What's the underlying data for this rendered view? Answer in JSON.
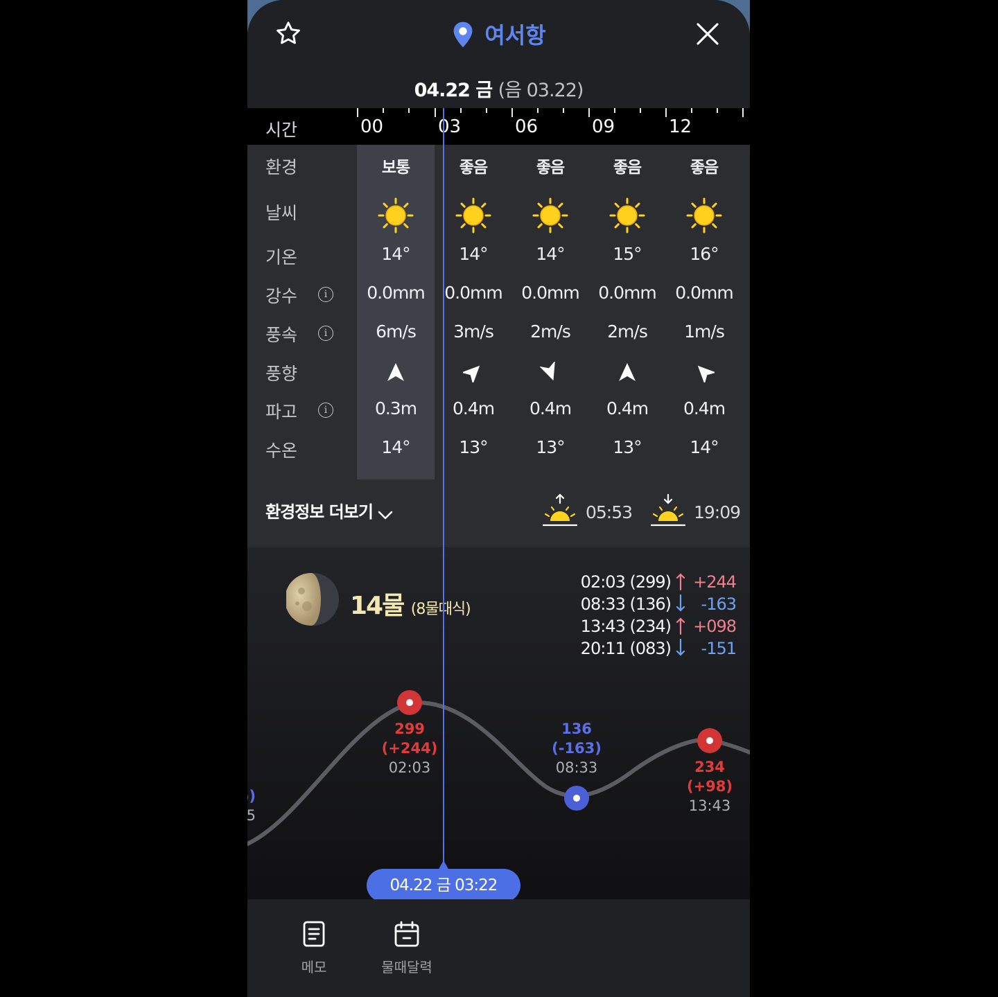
{
  "header": {
    "location": "여서항",
    "date_main": "04.22 금",
    "date_lunar": "(음 03.22)"
  },
  "time_row": {
    "label": "시간",
    "hours": [
      "00",
      "03",
      "06",
      "09",
      "12"
    ]
  },
  "row_labels": [
    "환경",
    "날씨",
    "기온",
    "강수",
    "풍속",
    "풍향",
    "파고",
    "수온"
  ],
  "columns": [
    {
      "env": "보통",
      "weather": "sun-icon",
      "temp": "14°",
      "rain": "0.0mm",
      "wind": "6m/s",
      "dir_deg": 0,
      "wave": "0.3m",
      "water": "14°"
    },
    {
      "env": "좋음",
      "weather": "sun-icon",
      "temp": "14°",
      "rain": "0.0mm",
      "wind": "3m/s",
      "dir_deg": 45,
      "wave": "0.4m",
      "water": "13°"
    },
    {
      "env": "좋음",
      "weather": "sun-icon",
      "temp": "14°",
      "rain": "0.0mm",
      "wind": "2m/s",
      "dir_deg": 160,
      "wave": "0.4m",
      "water": "13°"
    },
    {
      "env": "좋음",
      "weather": "sun-icon",
      "temp": "15°",
      "rain": "0.0mm",
      "wind": "2m/s",
      "dir_deg": 0,
      "wave": "0.4m",
      "water": "13°"
    },
    {
      "env": "좋음",
      "weather": "sun-icon",
      "temp": "16°",
      "rain": "0.0mm",
      "wind": "1m/s",
      "dir_deg": 315,
      "wave": "0.4m",
      "water": "14°"
    }
  ],
  "env_more": {
    "label": "환경정보 더보기",
    "sunrise": "05:53",
    "sunset": "19:09"
  },
  "tide": {
    "moon_label": "14물",
    "moon_sub": "(8물때식)",
    "entries": [
      {
        "time": "02:03 (299)",
        "dir": "up",
        "delta": "+244"
      },
      {
        "time": "08:33 (136)",
        "dir": "down",
        "delta": "-163"
      },
      {
        "time": "13:43 (234)",
        "dir": "up",
        "delta": "+098"
      },
      {
        "time": "20:11 (083)",
        "dir": "down",
        "delta": "-151"
      }
    ],
    "chart_points": [
      {
        "level": "299",
        "change": "(+244)",
        "time": "02:03",
        "kind": "high"
      },
      {
        "level": "136",
        "change": "(-163)",
        "time": "08:33",
        "kind": "low"
      },
      {
        "level": "234",
        "change": "(+98)",
        "time": "13:43",
        "kind": "high"
      }
    ],
    "partial_left": {
      "change": "5)",
      "time": "5"
    },
    "cursor_label": "04.22 금 03:22"
  },
  "nav": {
    "memo": "메모",
    "calendar": "물때달력"
  },
  "colors": {
    "accent": "#4c6fe6",
    "high": "#e23b3b",
    "low": "#5a6fe8",
    "sun": "#ffd21f"
  }
}
